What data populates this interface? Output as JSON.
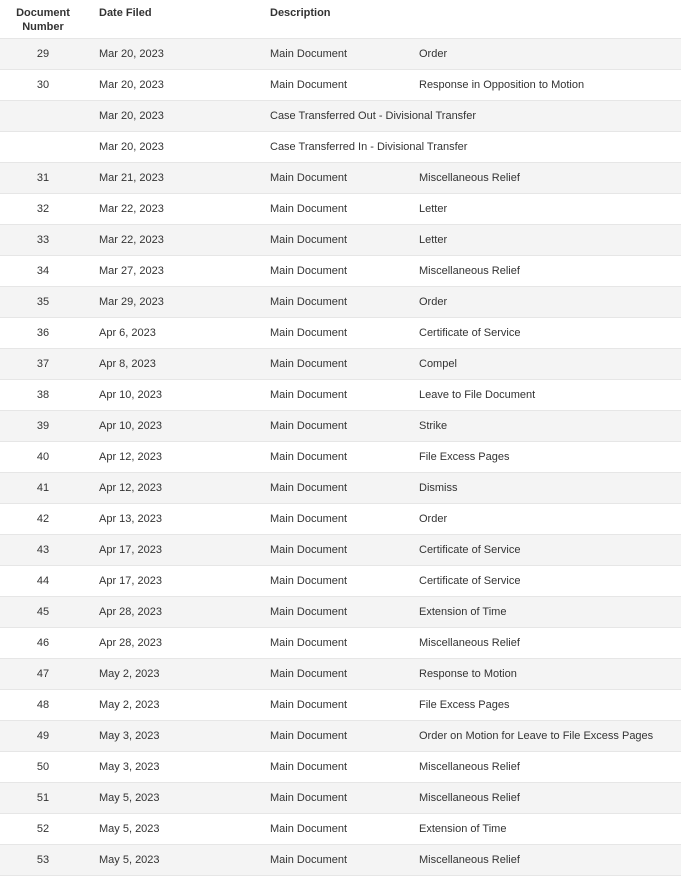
{
  "table": {
    "headers": {
      "number": "Document\nNumber",
      "date": "Date Filed",
      "description": "Description"
    },
    "rows": [
      {
        "number": "29",
        "date": "Mar 20, 2023",
        "type": "Main Document",
        "detail": "Order"
      },
      {
        "number": "30",
        "date": "Mar 20, 2023",
        "type": "Main Document",
        "detail": "Response in Opposition to Motion"
      },
      {
        "number": "",
        "date": "Mar 20, 2023",
        "type": "Case Transferred Out - Divisional Transfer",
        "detail": ""
      },
      {
        "number": "",
        "date": "Mar 20, 2023",
        "type": "Case Transferred In - Divisional Transfer",
        "detail": ""
      },
      {
        "number": "31",
        "date": "Mar 21, 2023",
        "type": "Main Document",
        "detail": "Miscellaneous Relief"
      },
      {
        "number": "32",
        "date": "Mar 22, 2023",
        "type": "Main Document",
        "detail": "Letter"
      },
      {
        "number": "33",
        "date": "Mar 22, 2023",
        "type": "Main Document",
        "detail": "Letter"
      },
      {
        "number": "34",
        "date": "Mar 27, 2023",
        "type": "Main Document",
        "detail": "Miscellaneous Relief"
      },
      {
        "number": "35",
        "date": "Mar 29, 2023",
        "type": "Main Document",
        "detail": "Order"
      },
      {
        "number": "36",
        "date": "Apr 6, 2023",
        "type": "Main Document",
        "detail": "Certificate of Service"
      },
      {
        "number": "37",
        "date": "Apr 8, 2023",
        "type": "Main Document",
        "detail": "Compel"
      },
      {
        "number": "38",
        "date": "Apr 10, 2023",
        "type": "Main Document",
        "detail": "Leave to File Document"
      },
      {
        "number": "39",
        "date": "Apr 10, 2023",
        "type": "Main Document",
        "detail": "Strike"
      },
      {
        "number": "40",
        "date": "Apr 12, 2023",
        "type": "Main Document",
        "detail": "File Excess Pages"
      },
      {
        "number": "41",
        "date": "Apr 12, 2023",
        "type": "Main Document",
        "detail": "Dismiss"
      },
      {
        "number": "42",
        "date": "Apr 13, 2023",
        "type": "Main Document",
        "detail": "Order"
      },
      {
        "number": "43",
        "date": "Apr 17, 2023",
        "type": "Main Document",
        "detail": "Certificate of Service"
      },
      {
        "number": "44",
        "date": "Apr 17, 2023",
        "type": "Main Document",
        "detail": "Certificate of Service"
      },
      {
        "number": "45",
        "date": "Apr 28, 2023",
        "type": "Main Document",
        "detail": "Extension of Time"
      },
      {
        "number": "46",
        "date": "Apr 28, 2023",
        "type": "Main Document",
        "detail": "Miscellaneous Relief"
      },
      {
        "number": "47",
        "date": "May 2, 2023",
        "type": "Main Document",
        "detail": "Response to Motion"
      },
      {
        "number": "48",
        "date": "May 2, 2023",
        "type": "Main Document",
        "detail": "File Excess Pages"
      },
      {
        "number": "49",
        "date": "May 3, 2023",
        "type": "Main Document",
        "detail": "Order on Motion for Leave to File Excess Pages"
      },
      {
        "number": "50",
        "date": "May 3, 2023",
        "type": "Main Document",
        "detail": "Miscellaneous Relief"
      },
      {
        "number": "51",
        "date": "May 5, 2023",
        "type": "Main Document",
        "detail": "Miscellaneous Relief"
      },
      {
        "number": "52",
        "date": "May 5, 2023",
        "type": "Main Document",
        "detail": "Extension of Time"
      },
      {
        "number": "53",
        "date": "May 5, 2023",
        "type": "Main Document",
        "detail": "Miscellaneous Relief"
      }
    ]
  }
}
